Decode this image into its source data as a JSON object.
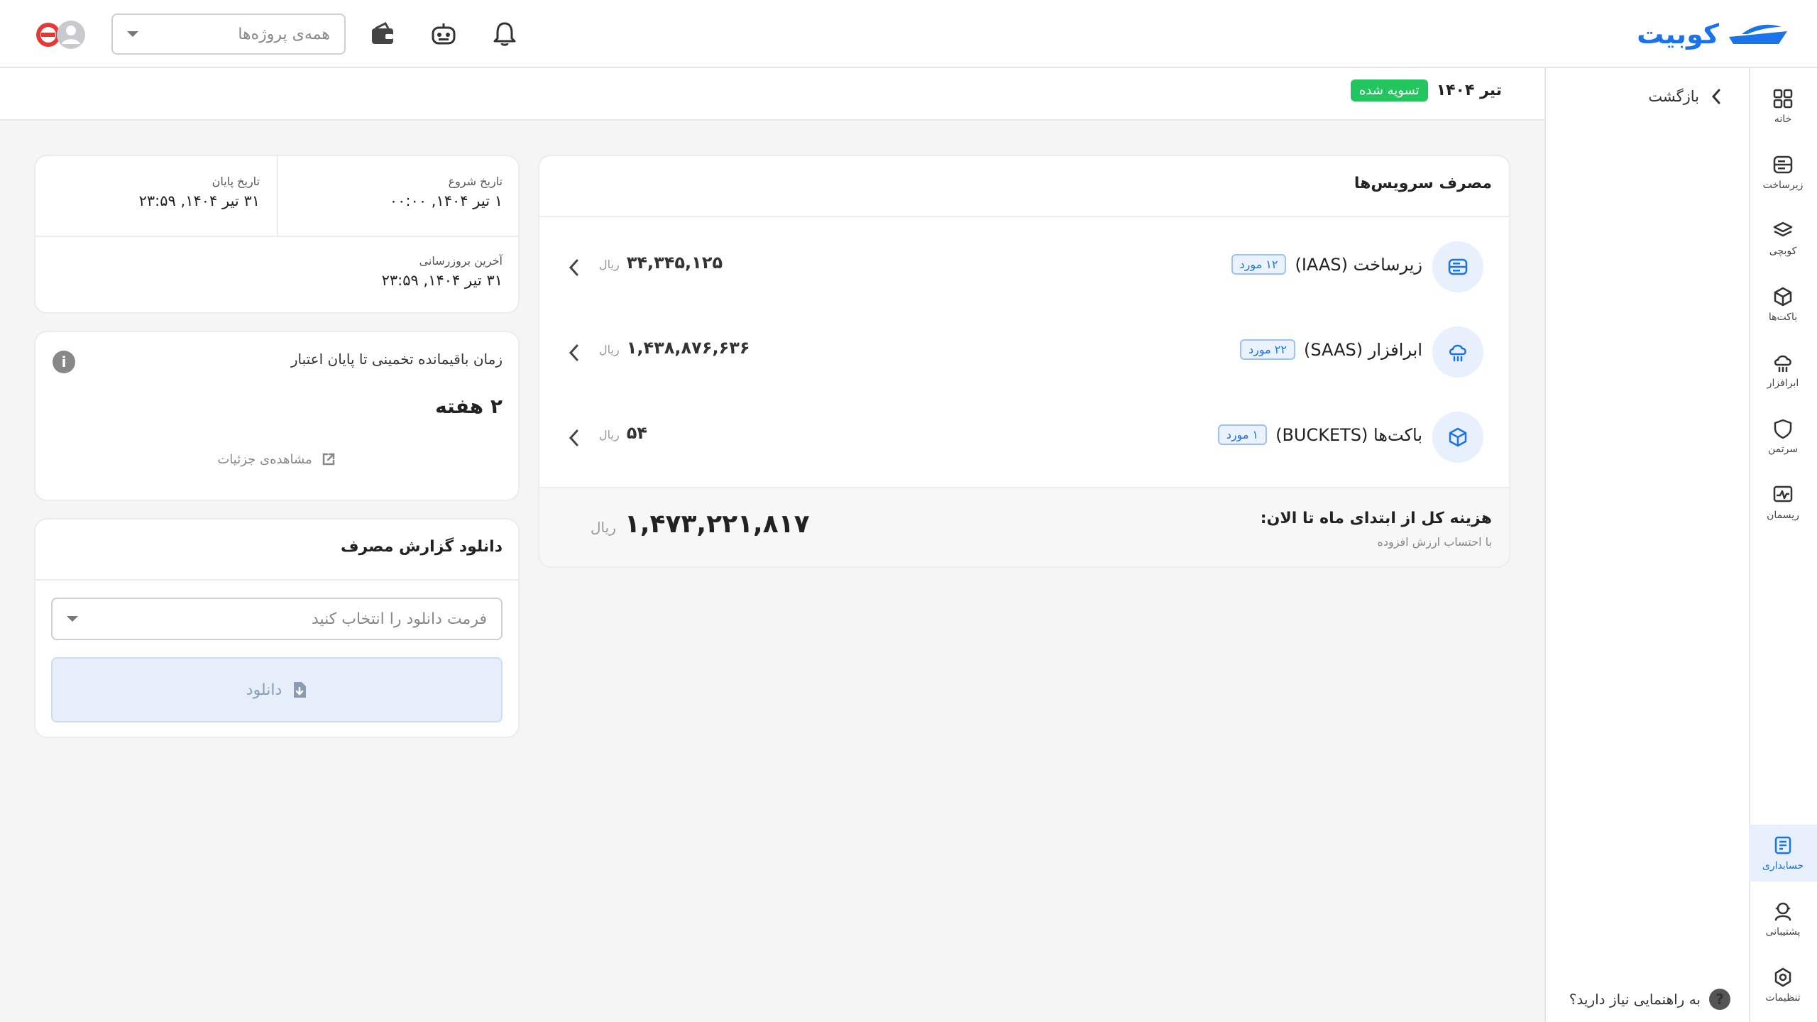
{
  "header": {
    "brand": "کوبیت",
    "project_placeholder": "همه‌ی پروژه‌ها",
    "icons": [
      "bell-icon",
      "robot-icon",
      "wallet-icon"
    ]
  },
  "sidebar": {
    "items": [
      {
        "label": "خانه",
        "icon": "grid-icon"
      },
      {
        "label": "زیرساخت",
        "icon": "server-icon"
      },
      {
        "label": "کوبچی",
        "icon": "layers-icon"
      },
      {
        "label": "باکت‌ها",
        "icon": "box-icon"
      },
      {
        "label": "ابرافزار",
        "icon": "cloud-icon"
      },
      {
        "label": "سرتمن",
        "icon": "shield-icon"
      },
      {
        "label": "ریسمان",
        "icon": "monitor-icon"
      },
      {
        "label": "حسابداری",
        "icon": "accounting-icon"
      },
      {
        "label": "پشتیبانی",
        "icon": "support-icon"
      },
      {
        "label": "تنظیمات",
        "icon": "settings-icon"
      }
    ],
    "active": "حسابداری"
  },
  "subside": {
    "back": "بازگشت",
    "help": "به راهنمایی نیاز دارید؟"
  },
  "page": {
    "title": "تیر ۱۴۰۴",
    "status": "تسویه شده"
  },
  "services": {
    "title": "مصرف سرویس‌ها",
    "rows": [
      {
        "name": "زیرساخت (IAAS)",
        "count": "۱۲ مورد",
        "amount": "۳۴,۳۴۵,۱۲۵",
        "unit": "ریال"
      },
      {
        "name": "ابرافزار (SAAS)",
        "count": "۲۲ مورد",
        "amount": "۱,۴۳۸,۸۷۶,۶۳۶",
        "unit": "ریال"
      },
      {
        "name": "باکت‌ها (BUCKETS)",
        "count": "۱ مورد",
        "amount": "۵۴",
        "unit": "ریال"
      }
    ],
    "total_label": "هزینه کل از ابتدای ماه تا الان:",
    "total_sub": "با احتساب ارزش افزوده",
    "total": "۱,۴۷۳,۲۲۱,۸۱۷",
    "total_unit": "ریال"
  },
  "dates": {
    "start_label": "تاریخ شروع",
    "start": "۱ تیر ۱۴۰۴, ۰۰:۰۰",
    "end_label": "تاریخ پایان",
    "end": "۳۱ تیر ۱۴۰۴, ۲۳:۵۹",
    "updated_label": "آخرین بروزرسانی",
    "updated": "۳۱ تیر ۱۴۰۴, ۲۳:۵۹"
  },
  "remain": {
    "label": "زمان باقیمانده تخمینی تا پایان اعتبار",
    "value": "۲ هفته",
    "link": "مشاهده‌ی جزئیات"
  },
  "download": {
    "title": "دانلود گزارش مصرف",
    "placeholder": "فرمت دانلود را انتخاب کنید",
    "button": "دانلود"
  }
}
